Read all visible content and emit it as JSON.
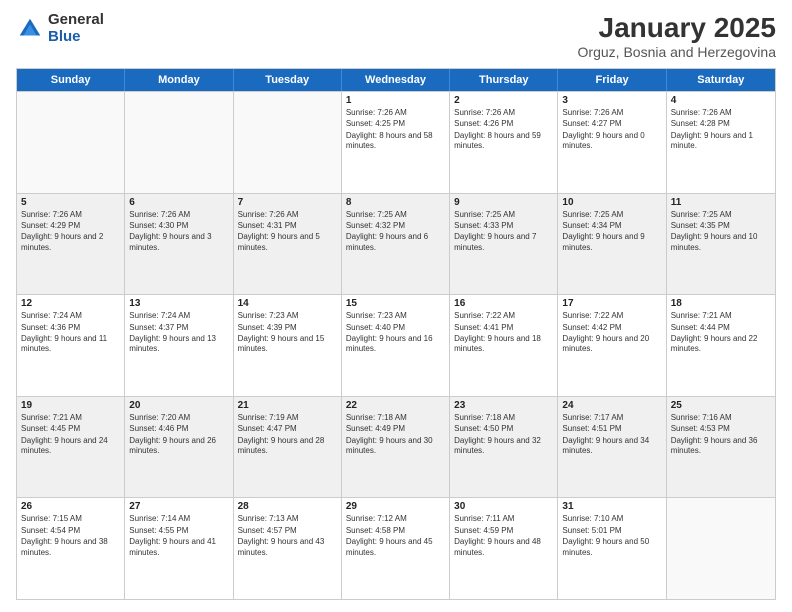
{
  "logo": {
    "general": "General",
    "blue": "Blue"
  },
  "title": "January 2025",
  "subtitle": "Orguz, Bosnia and Herzegovina",
  "days_of_week": [
    "Sunday",
    "Monday",
    "Tuesday",
    "Wednesday",
    "Thursday",
    "Friday",
    "Saturday"
  ],
  "rows": [
    [
      {
        "day": "",
        "info": "",
        "empty": true
      },
      {
        "day": "",
        "info": "",
        "empty": true
      },
      {
        "day": "",
        "info": "",
        "empty": true
      },
      {
        "day": "1",
        "sunrise": "Sunrise: 7:26 AM",
        "sunset": "Sunset: 4:25 PM",
        "daylight": "Daylight: 8 hours and 58 minutes."
      },
      {
        "day": "2",
        "sunrise": "Sunrise: 7:26 AM",
        "sunset": "Sunset: 4:26 PM",
        "daylight": "Daylight: 8 hours and 59 minutes."
      },
      {
        "day": "3",
        "sunrise": "Sunrise: 7:26 AM",
        "sunset": "Sunset: 4:27 PM",
        "daylight": "Daylight: 9 hours and 0 minutes."
      },
      {
        "day": "4",
        "sunrise": "Sunrise: 7:26 AM",
        "sunset": "Sunset: 4:28 PM",
        "daylight": "Daylight: 9 hours and 1 minute."
      }
    ],
    [
      {
        "day": "5",
        "sunrise": "Sunrise: 7:26 AM",
        "sunset": "Sunset: 4:29 PM",
        "daylight": "Daylight: 9 hours and 2 minutes."
      },
      {
        "day": "6",
        "sunrise": "Sunrise: 7:26 AM",
        "sunset": "Sunset: 4:30 PM",
        "daylight": "Daylight: 9 hours and 3 minutes."
      },
      {
        "day": "7",
        "sunrise": "Sunrise: 7:26 AM",
        "sunset": "Sunset: 4:31 PM",
        "daylight": "Daylight: 9 hours and 5 minutes."
      },
      {
        "day": "8",
        "sunrise": "Sunrise: 7:25 AM",
        "sunset": "Sunset: 4:32 PM",
        "daylight": "Daylight: 9 hours and 6 minutes."
      },
      {
        "day": "9",
        "sunrise": "Sunrise: 7:25 AM",
        "sunset": "Sunset: 4:33 PM",
        "daylight": "Daylight: 9 hours and 7 minutes."
      },
      {
        "day": "10",
        "sunrise": "Sunrise: 7:25 AM",
        "sunset": "Sunset: 4:34 PM",
        "daylight": "Daylight: 9 hours and 9 minutes."
      },
      {
        "day": "11",
        "sunrise": "Sunrise: 7:25 AM",
        "sunset": "Sunset: 4:35 PM",
        "daylight": "Daylight: 9 hours and 10 minutes."
      }
    ],
    [
      {
        "day": "12",
        "sunrise": "Sunrise: 7:24 AM",
        "sunset": "Sunset: 4:36 PM",
        "daylight": "Daylight: 9 hours and 11 minutes."
      },
      {
        "day": "13",
        "sunrise": "Sunrise: 7:24 AM",
        "sunset": "Sunset: 4:37 PM",
        "daylight": "Daylight: 9 hours and 13 minutes."
      },
      {
        "day": "14",
        "sunrise": "Sunrise: 7:23 AM",
        "sunset": "Sunset: 4:39 PM",
        "daylight": "Daylight: 9 hours and 15 minutes."
      },
      {
        "day": "15",
        "sunrise": "Sunrise: 7:23 AM",
        "sunset": "Sunset: 4:40 PM",
        "daylight": "Daylight: 9 hours and 16 minutes."
      },
      {
        "day": "16",
        "sunrise": "Sunrise: 7:22 AM",
        "sunset": "Sunset: 4:41 PM",
        "daylight": "Daylight: 9 hours and 18 minutes."
      },
      {
        "day": "17",
        "sunrise": "Sunrise: 7:22 AM",
        "sunset": "Sunset: 4:42 PM",
        "daylight": "Daylight: 9 hours and 20 minutes."
      },
      {
        "day": "18",
        "sunrise": "Sunrise: 7:21 AM",
        "sunset": "Sunset: 4:44 PM",
        "daylight": "Daylight: 9 hours and 22 minutes."
      }
    ],
    [
      {
        "day": "19",
        "sunrise": "Sunrise: 7:21 AM",
        "sunset": "Sunset: 4:45 PM",
        "daylight": "Daylight: 9 hours and 24 minutes."
      },
      {
        "day": "20",
        "sunrise": "Sunrise: 7:20 AM",
        "sunset": "Sunset: 4:46 PM",
        "daylight": "Daylight: 9 hours and 26 minutes."
      },
      {
        "day": "21",
        "sunrise": "Sunrise: 7:19 AM",
        "sunset": "Sunset: 4:47 PM",
        "daylight": "Daylight: 9 hours and 28 minutes."
      },
      {
        "day": "22",
        "sunrise": "Sunrise: 7:18 AM",
        "sunset": "Sunset: 4:49 PM",
        "daylight": "Daylight: 9 hours and 30 minutes."
      },
      {
        "day": "23",
        "sunrise": "Sunrise: 7:18 AM",
        "sunset": "Sunset: 4:50 PM",
        "daylight": "Daylight: 9 hours and 32 minutes."
      },
      {
        "day": "24",
        "sunrise": "Sunrise: 7:17 AM",
        "sunset": "Sunset: 4:51 PM",
        "daylight": "Daylight: 9 hours and 34 minutes."
      },
      {
        "day": "25",
        "sunrise": "Sunrise: 7:16 AM",
        "sunset": "Sunset: 4:53 PM",
        "daylight": "Daylight: 9 hours and 36 minutes."
      }
    ],
    [
      {
        "day": "26",
        "sunrise": "Sunrise: 7:15 AM",
        "sunset": "Sunset: 4:54 PM",
        "daylight": "Daylight: 9 hours and 38 minutes."
      },
      {
        "day": "27",
        "sunrise": "Sunrise: 7:14 AM",
        "sunset": "Sunset: 4:55 PM",
        "daylight": "Daylight: 9 hours and 41 minutes."
      },
      {
        "day": "28",
        "sunrise": "Sunrise: 7:13 AM",
        "sunset": "Sunset: 4:57 PM",
        "daylight": "Daylight: 9 hours and 43 minutes."
      },
      {
        "day": "29",
        "sunrise": "Sunrise: 7:12 AM",
        "sunset": "Sunset: 4:58 PM",
        "daylight": "Daylight: 9 hours and 45 minutes."
      },
      {
        "day": "30",
        "sunrise": "Sunrise: 7:11 AM",
        "sunset": "Sunset: 4:59 PM",
        "daylight": "Daylight: 9 hours and 48 minutes."
      },
      {
        "day": "31",
        "sunrise": "Sunrise: 7:10 AM",
        "sunset": "Sunset: 5:01 PM",
        "daylight": "Daylight: 9 hours and 50 minutes."
      },
      {
        "day": "",
        "info": "",
        "empty": true
      }
    ]
  ]
}
